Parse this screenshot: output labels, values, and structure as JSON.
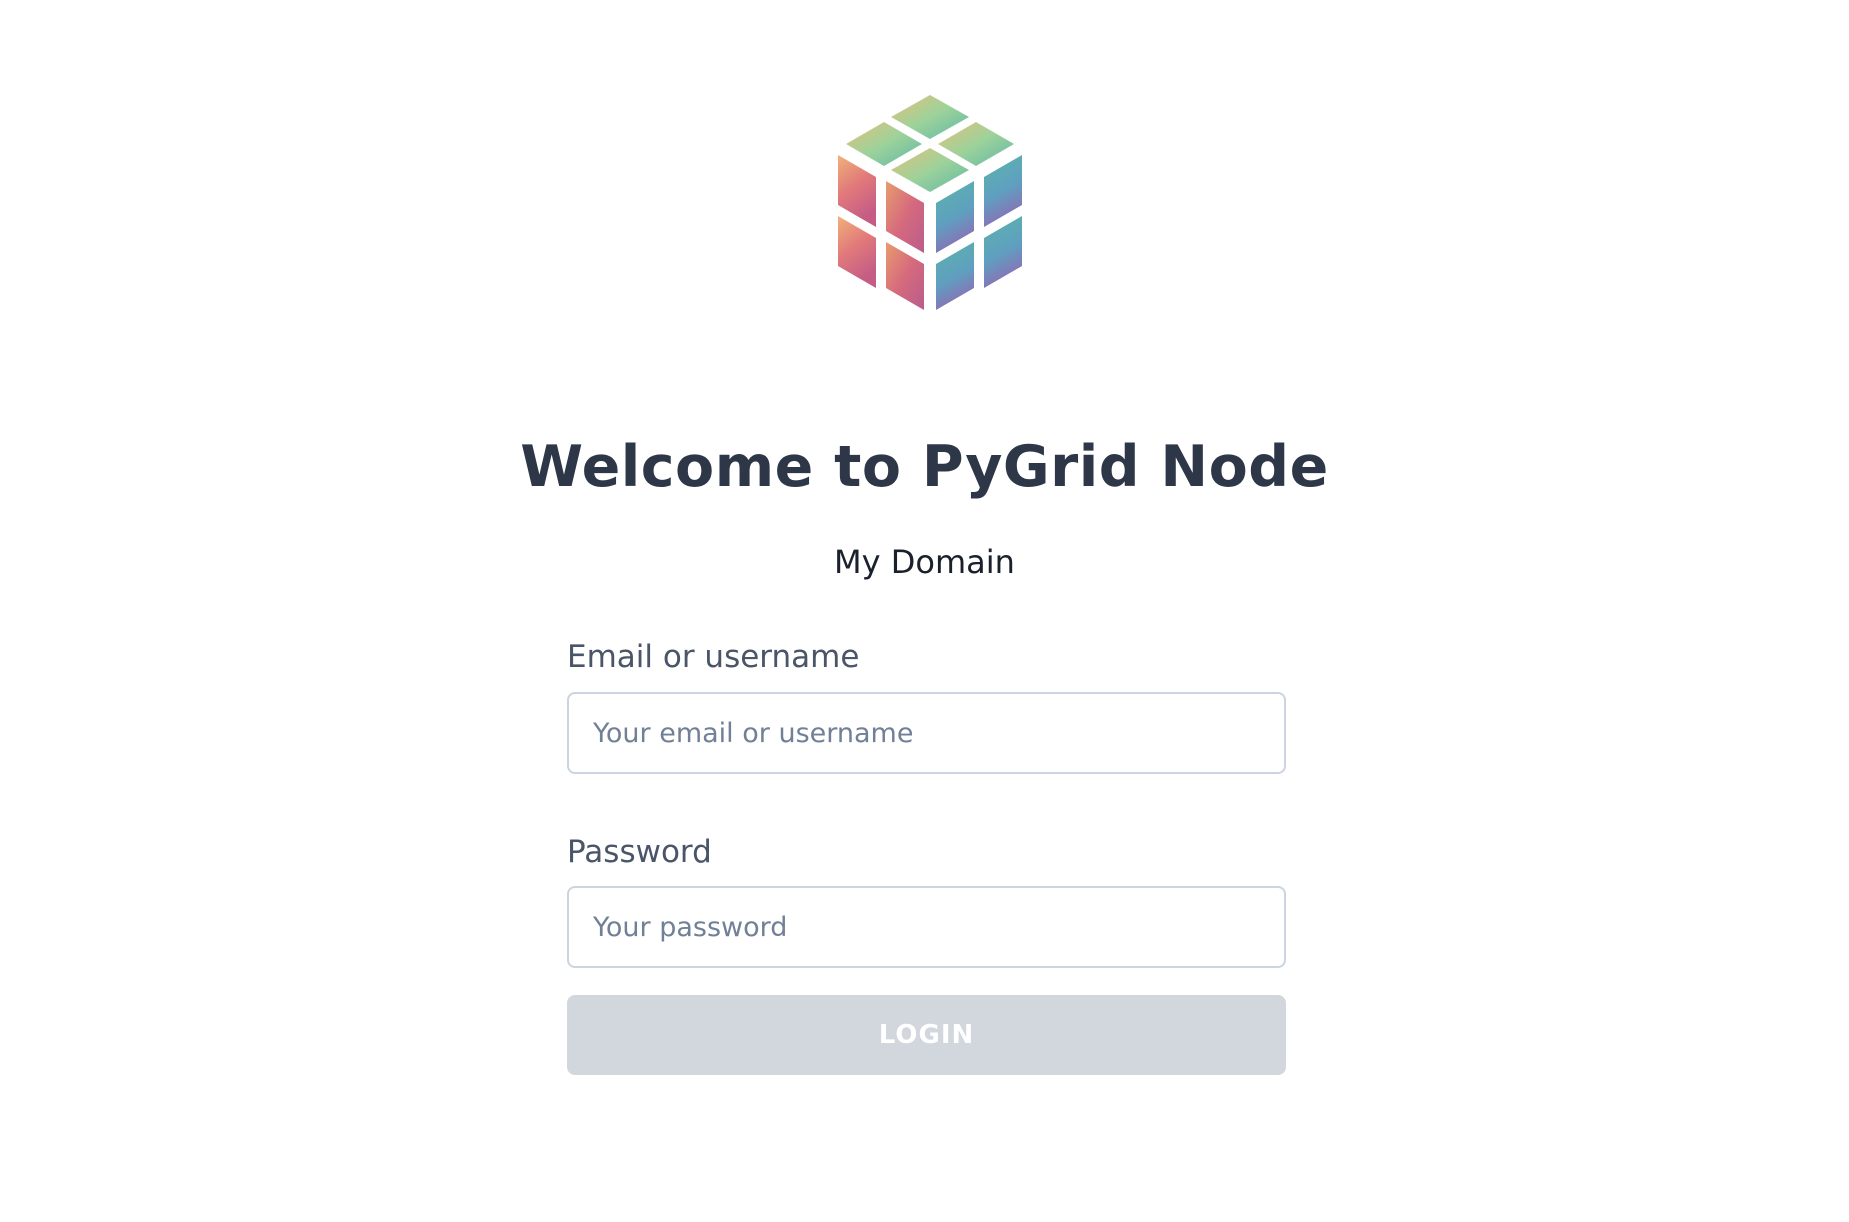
{
  "header": {
    "logo_icon": "pygrid-cube-icon",
    "title": "Welcome to PyGrid Node",
    "subtitle": "My Domain"
  },
  "form": {
    "email": {
      "label": "Email or username",
      "placeholder": "Your email or username",
      "value": ""
    },
    "password": {
      "label": "Password",
      "placeholder": "Your password",
      "value": ""
    },
    "submit": {
      "label": "LOGIN",
      "state": "disabled"
    }
  },
  "colors": {
    "title": "#2d3748",
    "subtitle": "#1a202c",
    "label": "#4a5568",
    "input_border": "#cbd5e0",
    "button_disabled": "#d2d6dd",
    "button_text": "#ffffff"
  }
}
